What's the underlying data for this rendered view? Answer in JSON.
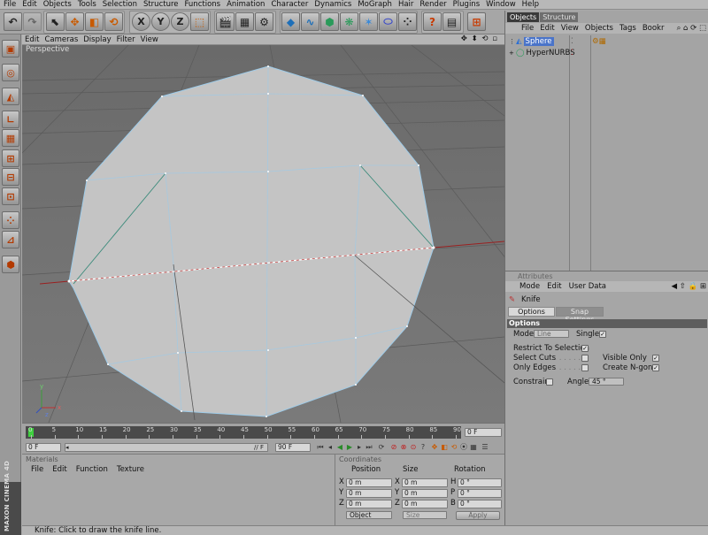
{
  "menubar": {
    "items": [
      "File",
      "Edit",
      "Objects",
      "Tools",
      "Selection",
      "Structure",
      "Functions",
      "Animation",
      "Character",
      "Dynamics",
      "MoGraph",
      "Hair",
      "Render",
      "Plugins",
      "Window",
      "Help"
    ]
  },
  "toolbar": {
    "axis_x": "X",
    "axis_y": "Y",
    "axis_z": "Z"
  },
  "viewport": {
    "menu": [
      "Edit",
      "Cameras",
      "Display",
      "Filter",
      "View"
    ],
    "nav_icons": "✥ ⬍ ⟲ ▫",
    "label": "Perspective",
    "axes": {
      "x": "x",
      "y": "y",
      "z": "z"
    }
  },
  "timeline": {
    "ticks": [
      "0",
      "5",
      "10",
      "15",
      "20",
      "25",
      "30",
      "35",
      "40",
      "45",
      "50",
      "55",
      "60",
      "65",
      "70",
      "75",
      "80",
      "85",
      "90"
    ],
    "current_frame": "0 F",
    "start_field": "0 F",
    "end_field": "90 F",
    "range_end_label": "// F",
    "playhead_fraction": 0.0
  },
  "materials": {
    "title": "Materials",
    "menu": [
      "File",
      "Edit",
      "Function",
      "Texture"
    ]
  },
  "coordinates": {
    "title": "Coordinates",
    "headers": [
      "Position",
      "Size",
      "Rotation"
    ],
    "rows": [
      {
        "axis": "X",
        "pos": "0 m",
        "size_axis": "X",
        "size": "0 m",
        "rot_axis": "H",
        "rot": "0 °"
      },
      {
        "axis": "Y",
        "pos": "0 m",
        "size_axis": "Y",
        "size": "0 m",
        "rot_axis": "P",
        "rot": "0 °"
      },
      {
        "axis": "Z",
        "pos": "0 m",
        "size_axis": "Z",
        "size": "0 m",
        "rot_axis": "B",
        "rot": "0 °"
      }
    ],
    "mode_select": "Object",
    "size_select": "Size",
    "apply_label": "Apply"
  },
  "objects_panel": {
    "tabs": [
      "Objects",
      "Structure"
    ],
    "menu": [
      "File",
      "Edit",
      "View",
      "Objects",
      "Tags",
      "Bookr"
    ],
    "items": [
      {
        "name": "Sphere"
      },
      {
        "name": "HyperNURBS"
      }
    ]
  },
  "attributes_panel": {
    "tab": "Attributes",
    "menu": [
      "Mode",
      "Edit",
      "User Data"
    ],
    "tool_name": "Knife",
    "subtabs": [
      "Options",
      "Snap Settings"
    ],
    "section": "Options",
    "mode_label": "Mode",
    "mode_value": "Line",
    "single_label": "Single",
    "restrict_label": "Restrict To Selection",
    "select_cuts_label": "Select Cuts",
    "visible_only_label": "Visible Only",
    "only_edges_label": "Only Edges",
    "create_ngons_label": "Create N-gons",
    "constrain_label": "Constrain",
    "angle_label": "Angle",
    "angle_value": "45 °"
  },
  "status": {
    "text": "Knife: Click to draw the knife line."
  },
  "logo": {
    "text": "MAXON CINEMA 4D"
  }
}
